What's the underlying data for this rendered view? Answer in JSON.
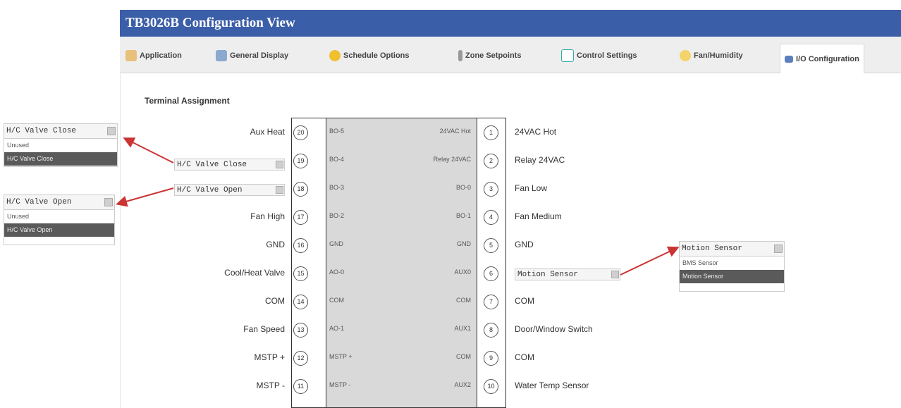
{
  "window": {
    "title": "TB3026B Configuration View"
  },
  "tabs": [
    {
      "label": "Application",
      "icon": "application-icon"
    },
    {
      "label": "General Display",
      "icon": "display-icon"
    },
    {
      "label": "Schedule Options",
      "icon": "schedule-icon"
    },
    {
      "label": "Zone Setpoints",
      "icon": "thermometer-icon"
    },
    {
      "label": "Control Settings",
      "icon": "control-icon"
    },
    {
      "label": "Fan/Humidity",
      "icon": "fan-icon"
    },
    {
      "label": "I/O Configuration",
      "icon": "io-icon",
      "active": true
    }
  ],
  "section_title": "Terminal Assignment",
  "rows": [
    {
      "left_label": "Aux Heat",
      "left_num": "20",
      "inner_left": "BO-5",
      "inner_right": "24VAC Hot",
      "right_num": "1",
      "right_label": "24VAC Hot"
    },
    {
      "left_label": "",
      "left_num": "19",
      "inner_left": "BO-4",
      "inner_right": "Relay 24VAC",
      "right_num": "2",
      "right_label": "Relay 24VAC"
    },
    {
      "left_label": "",
      "left_num": "18",
      "inner_left": "BO-3",
      "inner_right": "BO-0",
      "right_num": "3",
      "right_label": "Fan Low"
    },
    {
      "left_label": "Fan High",
      "left_num": "17",
      "inner_left": "BO-2",
      "inner_right": "BO-1",
      "right_num": "4",
      "right_label": "Fan Medium"
    },
    {
      "left_label": "GND",
      "left_num": "16",
      "inner_left": "GND",
      "inner_right": "GND",
      "right_num": "5",
      "right_label": "GND"
    },
    {
      "left_label": "Cool/Heat Valve",
      "left_num": "15",
      "inner_left": "AO-0",
      "inner_right": "AUX0",
      "right_num": "6",
      "right_label": ""
    },
    {
      "left_label": "COM",
      "left_num": "14",
      "inner_left": "COM",
      "inner_right": "COM",
      "right_num": "7",
      "right_label": "COM"
    },
    {
      "left_label": "Fan Speed",
      "left_num": "13",
      "inner_left": "AO-1",
      "inner_right": "AUX1",
      "right_num": "8",
      "right_label": "Door/Window Switch"
    },
    {
      "left_label": "MSTP +",
      "left_num": "12",
      "inner_left": "MSTP +",
      "inner_right": "COM",
      "right_num": "9",
      "right_label": "COM"
    },
    {
      "left_label": "MSTP -",
      "left_num": "11",
      "inner_left": "MSTP -",
      "inner_right": "AUX2",
      "right_num": "10",
      "right_label": "Water Temp Sensor"
    }
  ],
  "selects": {
    "valve_close": "H/C Valve Close",
    "valve_open": "H/C Valve Open",
    "motion": "Motion Sensor"
  },
  "dropdowns": {
    "valve_close": {
      "value": "H/C Valve Close",
      "options": [
        "Unused",
        "H/C Valve Close"
      ],
      "selected": 1
    },
    "valve_open": {
      "value": "H/C Valve Open",
      "options": [
        "Unused",
        "H/C Valve Open"
      ],
      "selected": 1
    },
    "motion": {
      "value": "Motion Sensor",
      "options": [
        "BMS Sensor",
        "Motion Sensor"
      ],
      "selected": 1
    }
  },
  "colors": {
    "titlebar": "#3b5ea8",
    "arrow": "#cc3333",
    "board_inner": "#d9d9d9"
  }
}
